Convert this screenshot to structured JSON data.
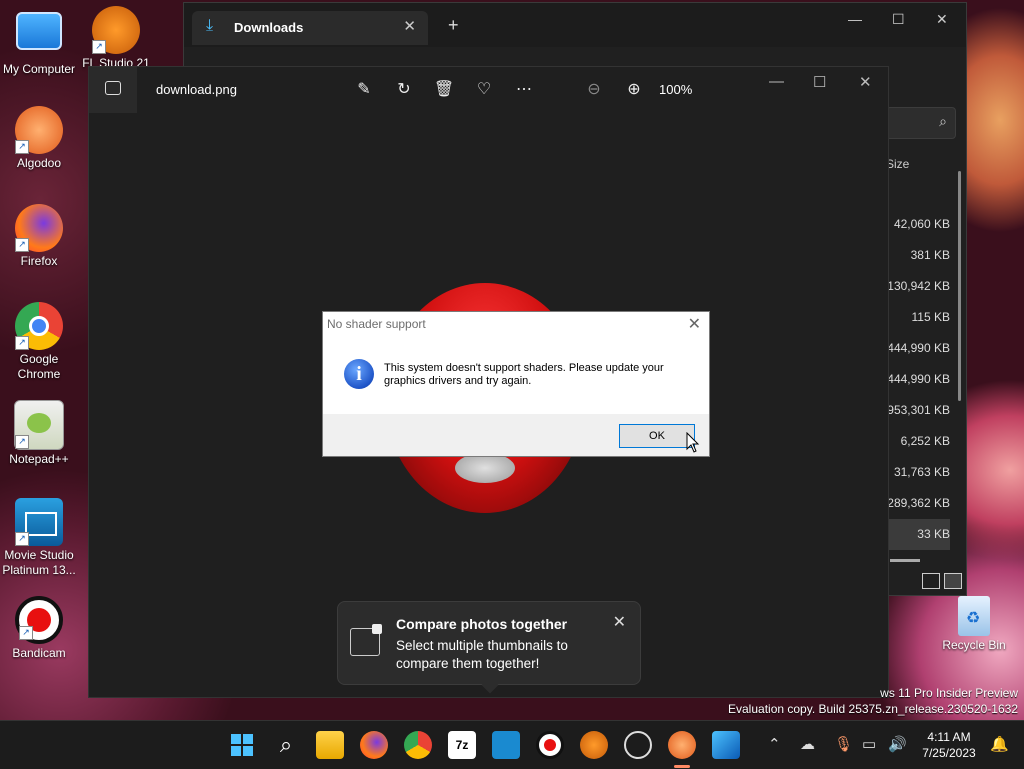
{
  "desktop": {
    "icons": [
      {
        "label": "My Computer"
      },
      {
        "label": "FL Studio 21"
      },
      {
        "label": "Algodoo"
      },
      {
        "label": "Firefox"
      },
      {
        "label": "Google Chrome"
      },
      {
        "label": "Notepad++"
      },
      {
        "label": "Movie Studio Platinum 13..."
      },
      {
        "label": "Bandicam"
      },
      {
        "label": "Recycle Bin"
      }
    ],
    "watermark_line1": "ws 11 Pro Insider Preview",
    "watermark_line2": "Evaluation copy. Build 25375.zn_release.230520-1632"
  },
  "explorer": {
    "tab_title": "Downloads",
    "column_size": "Size",
    "sizes": [
      "42,060 KB",
      "381 KB",
      "130,942 KB",
      "115 KB",
      "444,990 KB",
      "444,990 KB",
      "953,301 KB",
      "6,252 KB",
      "31,763 KB",
      "289,362 KB",
      "33 KB"
    ]
  },
  "photos": {
    "file_name": "download.png",
    "zoom": "100%",
    "toast": {
      "title": "Compare photos together",
      "body": "Select multiple thumbnails to compare them together!"
    }
  },
  "dialog": {
    "title": "No shader support",
    "message": "This system doesn't support shaders. Please update your graphics drivers and try again.",
    "ok_label": "OK"
  },
  "taskbar": {
    "time": "4:11 AM",
    "date": "7/25/2023"
  },
  "colors": {
    "accent": "#0078d7",
    "explorer_icon": "#4cc2ff"
  }
}
